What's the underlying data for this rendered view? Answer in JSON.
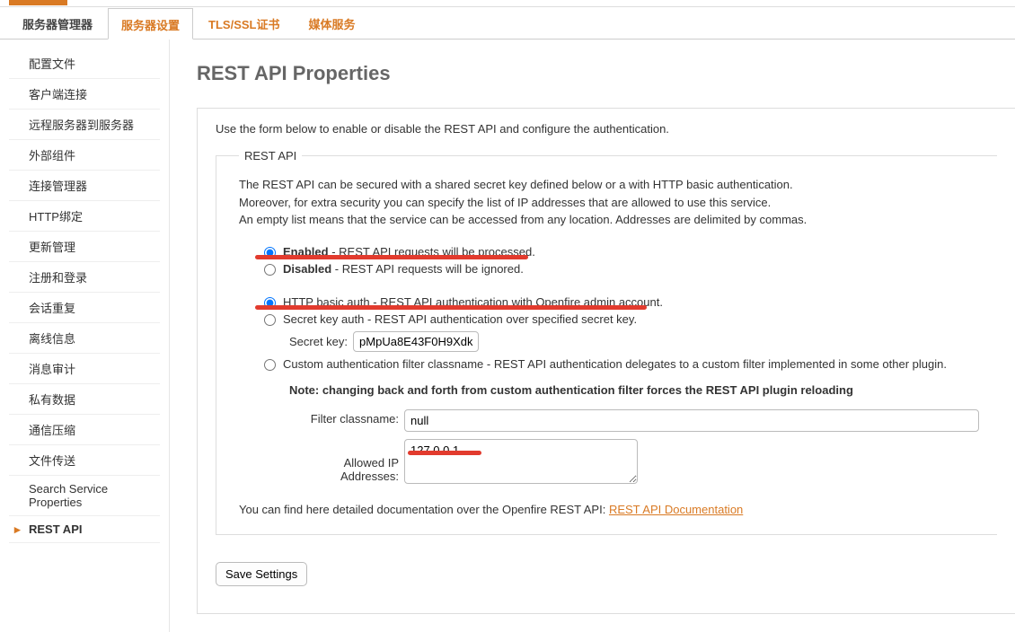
{
  "tabs": {
    "t0": "服务器管理器",
    "t1": "服务器设置",
    "t2": "TLS/SSL证书",
    "t3": "媒体服务"
  },
  "sidebar": {
    "items": [
      "配置文件",
      "客户端连接",
      "远程服务器到服务器",
      "外部组件",
      "连接管理器",
      "HTTP绑定",
      "更新管理",
      "注册和登录",
      "会话重复",
      "离线信息",
      "消息审计",
      "私有数据",
      "通信压缩",
      "文件传送",
      "Search Service Properties",
      "REST API"
    ]
  },
  "page": {
    "title": "REST API Properties",
    "intro": "Use the form below to enable or disable the REST API and configure the authentication.",
    "legend": "REST API",
    "desc1": "The REST API can be secured with a shared secret key defined below or a with HTTP basic authentication.",
    "desc2": "Moreover, for extra security you can specify the list of IP addresses that are allowed to use this service.",
    "desc3": "An empty list means that the service can be accessed from any location. Addresses are delimited by commas.",
    "enabled_b": "Enabled",
    "enabled_rest": " - REST API requests will be processed.",
    "disabled_b": "Disabled",
    "disabled_rest": " - REST API requests will be ignored.",
    "httpauth": "HTTP basic auth - REST API authentication with Openfire admin account.",
    "secretkey_radio": "Secret key auth - REST API authentication over specified secret key.",
    "secretkey_label": "Secret key:",
    "secretkey_value": "pMpUa8E43F0H9Xdk",
    "custom_radio": "Custom authentication filter classname - REST API authentication delegates to a custom filter implemented in some other plugin.",
    "note": "Note: changing back and forth from custom authentication filter forces the REST API plugin reloading",
    "filter_label": "Filter classname:",
    "filter_value": "null",
    "allowed_label": "Allowed IP Addresses:",
    "allowed_value": "127.0.0.1",
    "doc_text": "You can find here detailed documentation over the Openfire REST API: ",
    "doc_link": "REST API Documentation",
    "save": "Save Settings"
  }
}
